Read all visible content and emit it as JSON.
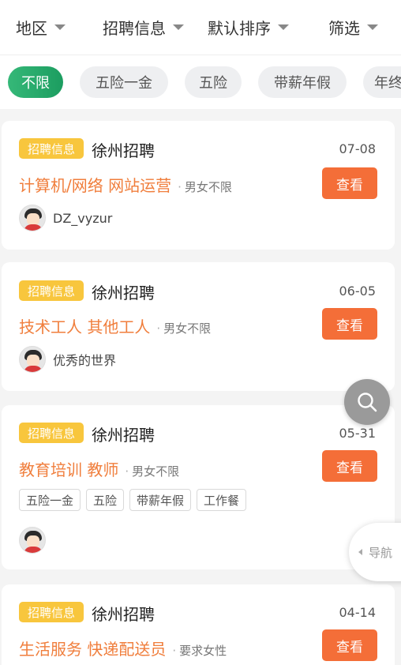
{
  "filters": [
    {
      "label": "地区"
    },
    {
      "label": "招聘信息"
    },
    {
      "label": "默认排序"
    },
    {
      "label": "筛选"
    }
  ],
  "tags": [
    {
      "label": "不限",
      "active": true
    },
    {
      "label": "五险一金"
    },
    {
      "label": "五险"
    },
    {
      "label": "带薪年假"
    },
    {
      "label": "年终奖"
    }
  ],
  "listings": [
    {
      "badge": "招聘信息",
      "city": "徐州招聘",
      "date": "07-08",
      "title": "计算机/网络 网站运营",
      "requirement": "男女不限",
      "view_label": "查看",
      "user": "DZ_vyzur"
    },
    {
      "badge": "招聘信息",
      "city": "徐州招聘",
      "date": "06-05",
      "title": "技术工人 其他工人",
      "requirement": "男女不限",
      "view_label": "查看",
      "user": "优秀的世界"
    },
    {
      "badge": "招聘信息",
      "city": "徐州招聘",
      "date": "05-31",
      "title": "教育培训 教师",
      "requirement": "男女不限",
      "view_label": "查看",
      "welfare": [
        "五险一金",
        "五险",
        "带薪年假",
        "工作餐"
      ]
    },
    {
      "badge": "招聘信息",
      "city": "徐州招聘",
      "date": "04-14",
      "title": "生活服务 快递配送员",
      "requirement": "要求女性",
      "view_label": "查看"
    }
  ],
  "nav_fab": {
    "label": "导航"
  },
  "icons": {
    "search": "search-icon",
    "nav": "nav-arrow-icon",
    "avatar": "avatar-icon",
    "dropdown": "caret-down-icon"
  },
  "colors": {
    "accent": "#f46e38",
    "badge": "#f8c63d",
    "active_tag": "#1c9d60",
    "title": "#f07e3c"
  }
}
